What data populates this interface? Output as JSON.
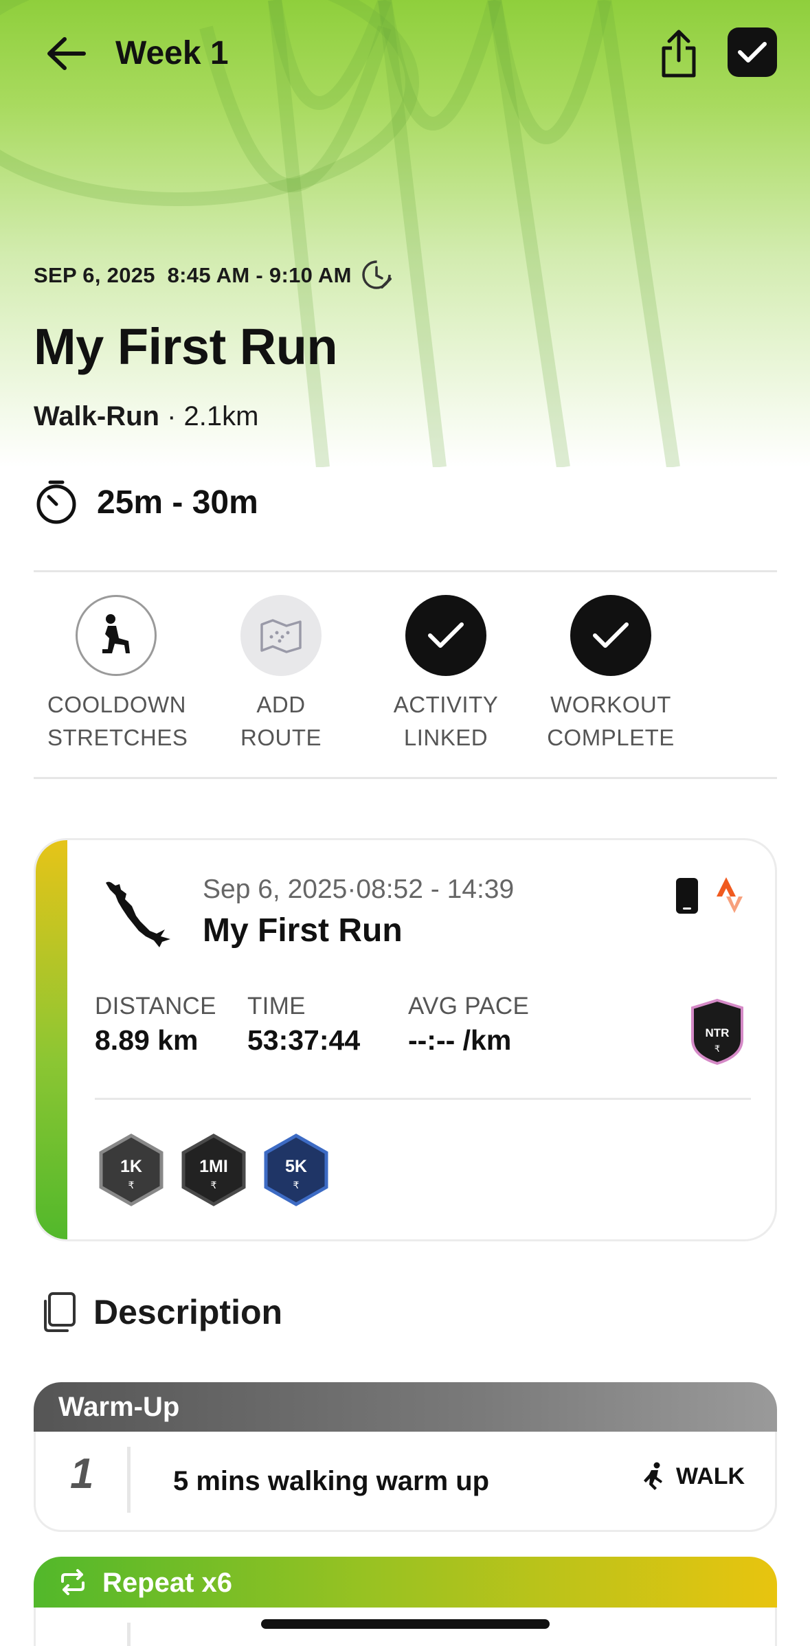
{
  "header": {
    "title": "Week 1",
    "back_icon": "arrow-left-icon",
    "share_icon": "share-icon",
    "complete_icon": "checkmark-icon"
  },
  "workout": {
    "datetime": "SEP 6, 2025  8:45 AM - 9:10 AM",
    "title": "My First Run",
    "type": "Walk-Run",
    "distance": "· 2.1km",
    "duration": "25m - 30m"
  },
  "actions": [
    {
      "label_line1": "COOLDOWN",
      "label_line2": "STRETCHES",
      "icon": "stretch-icon"
    },
    {
      "label_line1": "ADD",
      "label_line2": "ROUTE",
      "icon": "map-icon"
    },
    {
      "label_line1": "ACTIVITY",
      "label_line2": "LINKED",
      "icon": "checkmark-icon"
    },
    {
      "label_line1": "WORKOUT",
      "label_line2": "COMPLETE",
      "icon": "checkmark-icon"
    }
  ],
  "activity": {
    "date": "Sep 6, 2025·08:52 - 14:39",
    "title": "My First Run",
    "stats": [
      {
        "label": "DISTANCE",
        "value": "8.89 km"
      },
      {
        "label": "TIME",
        "value": "53:37:44"
      },
      {
        "label": "AVG PACE",
        "value": "--:-- /km"
      }
    ],
    "ntr_badge": "NTR",
    "badges": [
      "1K",
      "1MI",
      "5K"
    ],
    "accent_colors": [
      "#e6c418",
      "#52b82b"
    ]
  },
  "description": {
    "title": "Description"
  },
  "steps": {
    "warmup_header": "Warm-Up",
    "warmup_items": [
      {
        "number": "1",
        "text": "5 mins walking warm up",
        "tag": "WALK"
      }
    ],
    "repeat_header": "Repeat x6"
  }
}
